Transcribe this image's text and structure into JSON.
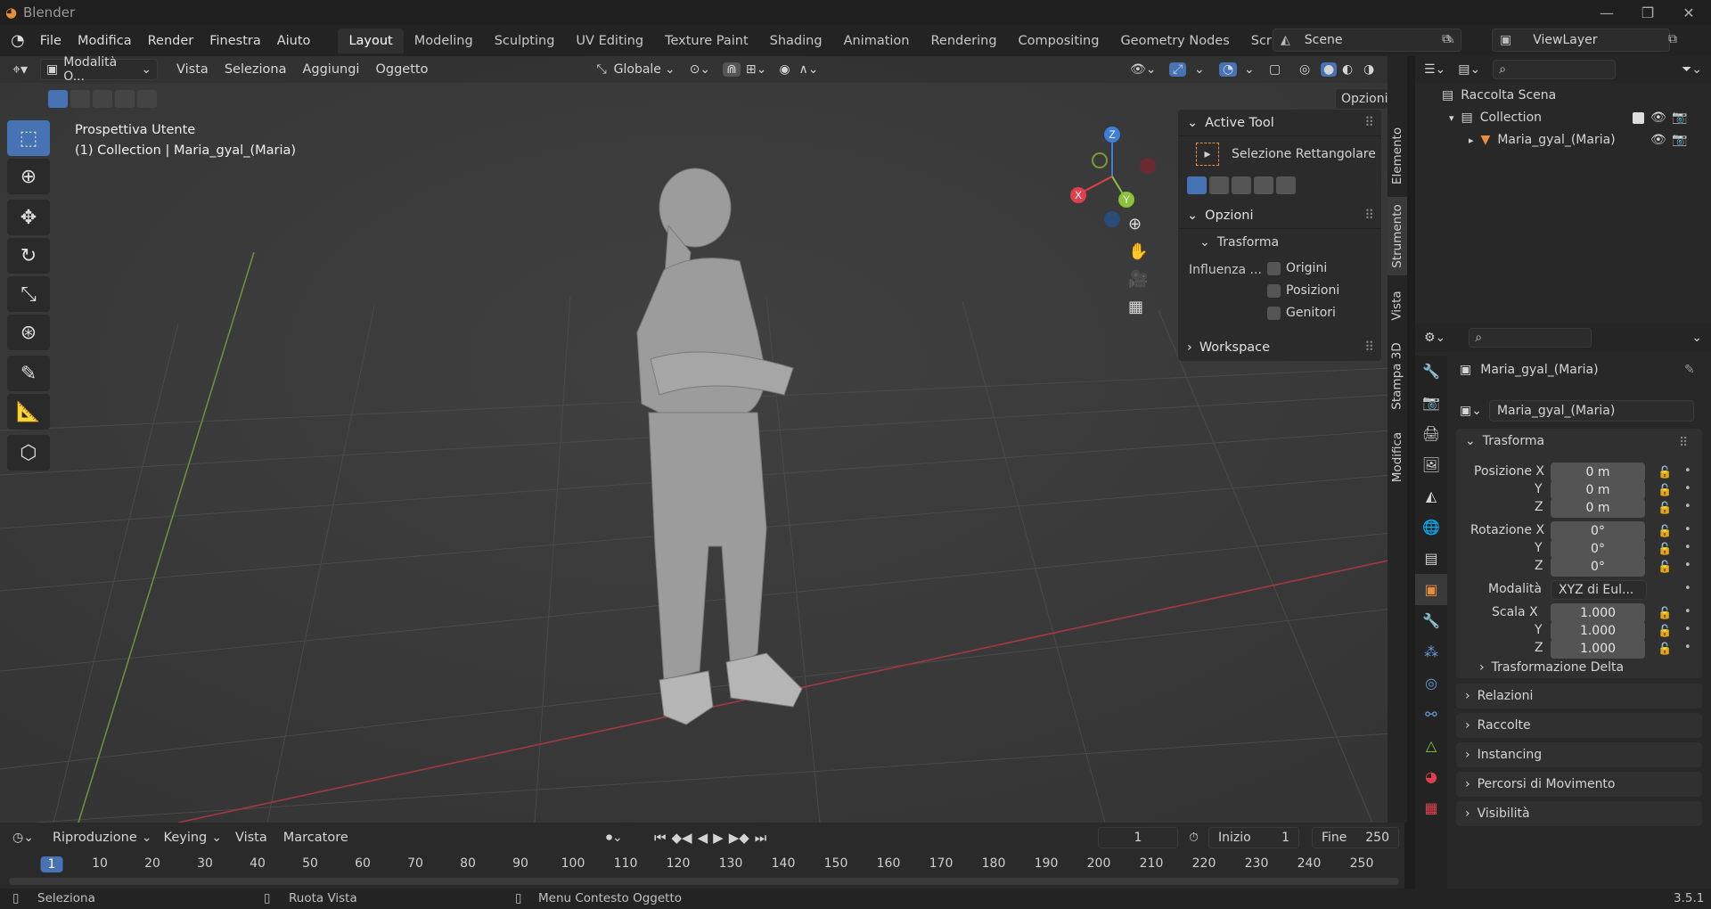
{
  "window": {
    "title": "Blender",
    "minimize": "—",
    "maximize": "❐",
    "close": "✕"
  },
  "menu": {
    "file": "File",
    "edit": "Modifica",
    "render": "Render",
    "window": "Finestra",
    "help": "Aiuto"
  },
  "workspaces": [
    "Layout",
    "Modeling",
    "Sculpting",
    "UV Editing",
    "Texture Paint",
    "Shading",
    "Animation",
    "Rendering",
    "Compositing",
    "Geometry Nodes",
    "Scripting"
  ],
  "scene": {
    "name": "Scene",
    "view_layer": "ViewLayer"
  },
  "viewport_header": {
    "mode": "Modalità O...",
    "view": "Vista",
    "select": "Seleziona",
    "add": "Aggiungi",
    "object": "Oggetto",
    "orientation": "Globale",
    "options": "Opzioni"
  },
  "viewport": {
    "perspective": "Prospettiva Utente",
    "context": "(1) Collection | Maria_gyal_(Maria)"
  },
  "gizmo": {
    "x": "X",
    "y": "Y",
    "z": "Z"
  },
  "npanel": {
    "active_tool": "Active Tool",
    "tool_name": "Selezione Rettangolare",
    "options": "Opzioni",
    "transform": "Trasforma",
    "influence": "Influenza ...",
    "origins": "Origini",
    "positions": "Posizioni",
    "parents": "Genitori",
    "workspace": "Workspace"
  },
  "side_tabs": [
    "Elemento",
    "Strumento",
    "Vista",
    "Stampa 3D",
    "Modifica"
  ],
  "outliner": {
    "scene_collection": "Raccolta Scena",
    "collection": "Collection",
    "object": "Maria_gyal_(Maria)"
  },
  "properties": {
    "object_name": "Maria_gyal_(Maria)",
    "data_name": "Maria_gyal_(Maria)",
    "transform": "Trasforma",
    "location_label": "Posizione X",
    "loc": [
      "0 m",
      "0 m",
      "0 m"
    ],
    "rotation_label": "Rotazione X",
    "rot": [
      "0°",
      "0°",
      "0°"
    ],
    "mode_label": "Modalità",
    "mode_value": "XYZ di Eul...",
    "scale_label": "Scala X",
    "scale": [
      "1.000",
      "1.000",
      "1.000"
    ],
    "axis_y": "Y",
    "axis_z": "Z",
    "delta": "Trasformazione Delta",
    "relations": "Relazioni",
    "collections": "Raccolte",
    "instancing": "Instancing",
    "motion_paths": "Percorsi di Movimento",
    "visibility": "Visibilità"
  },
  "timeline": {
    "playback": "Riproduzione",
    "keying": "Keying",
    "view": "Vista",
    "marker": "Marcatore",
    "current_frame": "1",
    "start_label": "Inizio",
    "start": "1",
    "end_label": "Fine",
    "end": "250",
    "ticks": [
      "1",
      "10",
      "20",
      "30",
      "40",
      "50",
      "60",
      "70",
      "80",
      "90",
      "100",
      "110",
      "120",
      "130",
      "140",
      "150",
      "160",
      "170",
      "180",
      "190",
      "200",
      "210",
      "220",
      "230",
      "240",
      "250"
    ]
  },
  "status": {
    "select": "Seleziona",
    "rotate": "Ruota Vista",
    "context": "Menu Contesto Oggetto",
    "version": "3.5.1"
  },
  "colors": {
    "accent": "#4772b3",
    "x_axis": "#e0404d",
    "y_axis": "#8ac33a",
    "z_axis": "#3b7fd9",
    "object_orange": "#e88d3a"
  }
}
